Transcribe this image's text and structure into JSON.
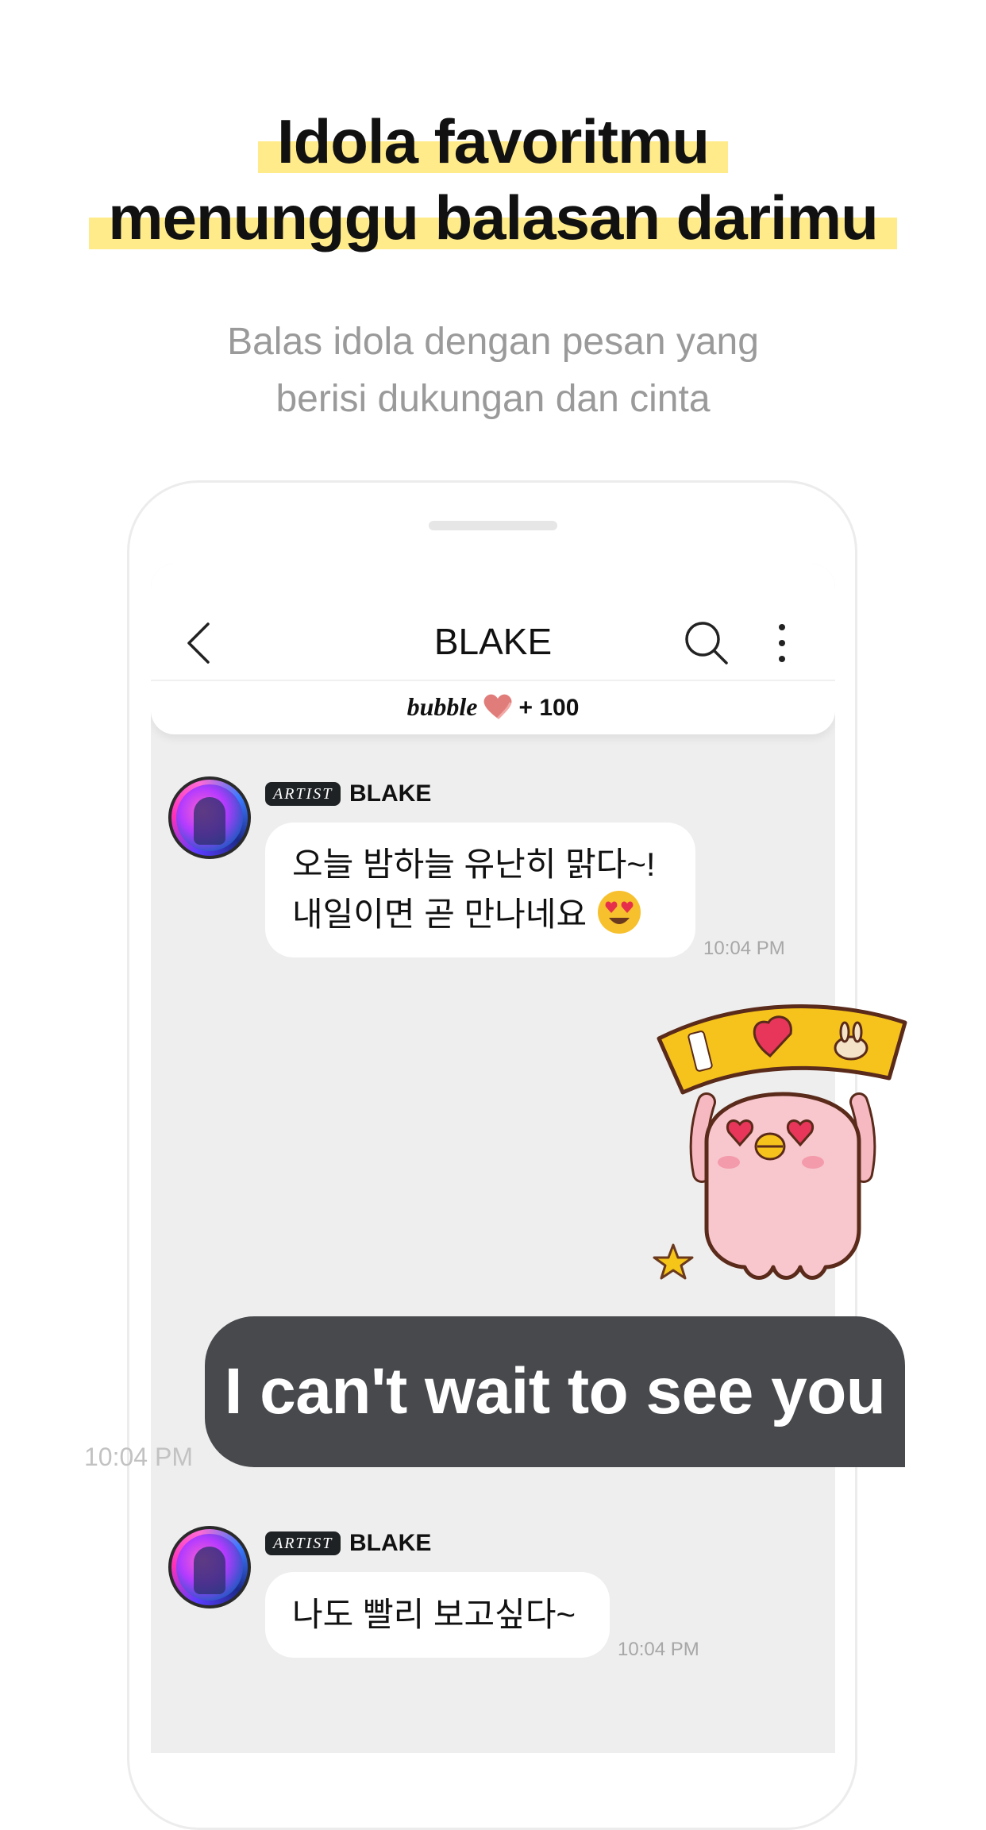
{
  "headline": {
    "line1": "Idola favoritmu",
    "line2": "menunggu balasan darimu"
  },
  "subtitle": {
    "line1": "Balas idola dengan pesan yang",
    "line2": "berisi dukungan dan cinta"
  },
  "chat": {
    "header": {
      "title": "BLAKE",
      "bubble_brand": "bubble",
      "bubble_count": "+ 100"
    },
    "messages": [
      {
        "badge": "ARTIST",
        "sender": "BLAKE",
        "line1": "오늘 밤하늘 유난히 맑다~!",
        "line2": "내일이면 곧 만나네요",
        "time": "10:04 PM"
      },
      {
        "text": "I can't wait to see you",
        "time": "10:04 PM"
      },
      {
        "badge": "ARTIST",
        "sender": "BLAKE",
        "line1": "나도 빨리 보고싶다~",
        "time": "10:04 PM"
      }
    ]
  },
  "icons": {
    "back": "chevron-left-icon",
    "search": "search-icon",
    "more": "more-vertical-icon",
    "heart": "heart-icon",
    "emoji": "heart-eyes-emoji",
    "sticker": "i-love-sign-sticker"
  },
  "colors": {
    "highlight": "#ffeb8a",
    "reply_bubble": "#47494c",
    "chat_background": "#eeeeee"
  }
}
